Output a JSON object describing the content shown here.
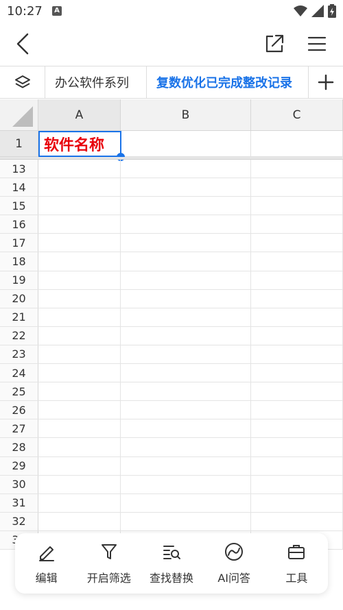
{
  "status_bar": {
    "time": "10:27",
    "notification_icon_letter": "A"
  },
  "app_bar": {
    "back_icon": "chevron-left-icon",
    "share_icon": "open-external-icon",
    "menu_icon": "hamburger-menu-icon"
  },
  "tabs": {
    "layers_icon": "layers-icon",
    "items": [
      {
        "label": "办公软件系列"
      },
      {
        "label": "复数优化已完成整改记录"
      }
    ],
    "add_icon": "plus-icon"
  },
  "grid": {
    "columns": [
      "A",
      "B",
      "C"
    ],
    "frozen_row": {
      "number": "1",
      "a1_value": "软件名称"
    },
    "rows": [
      "13",
      "14",
      "15",
      "16",
      "17",
      "18",
      "19",
      "20",
      "21",
      "22",
      "23",
      "24",
      "25",
      "26",
      "27",
      "28",
      "29",
      "30",
      "31",
      "32",
      "33"
    ]
  },
  "toolbar": {
    "items": [
      {
        "label": "编辑",
        "icon": "pencil-icon"
      },
      {
        "label": "开启筛选",
        "icon": "filter-icon"
      },
      {
        "label": "查找替换",
        "icon": "find-replace-icon"
      },
      {
        "label": "AI问答",
        "icon": "ai-assistant-icon"
      },
      {
        "label": "工具",
        "icon": "toolbox-icon"
      }
    ]
  },
  "colors": {
    "accent": "#1a73e8",
    "cell_text_red": "#e8000b"
  }
}
